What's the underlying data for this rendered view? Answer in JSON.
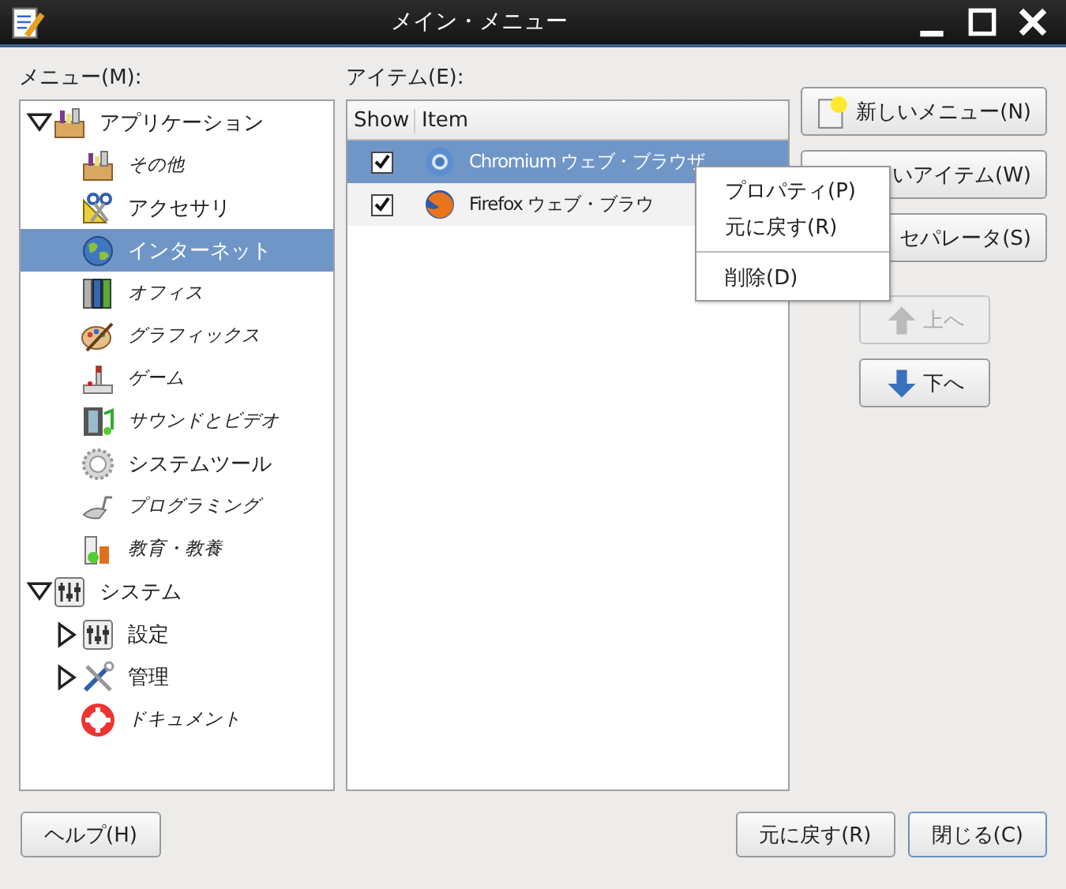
{
  "window": {
    "title": "メイン・メニュー"
  },
  "menu_label": "メニュー(M):",
  "items_label": "アイテム(E):",
  "tree": [
    {
      "label": "アプリケーション",
      "expanded": true,
      "selected": false,
      "italic": false,
      "children": [
        {
          "label": "その他",
          "selected": false,
          "italic": true
        },
        {
          "label": "アクセサリ",
          "selected": false,
          "italic": false
        },
        {
          "label": "インターネット",
          "selected": true,
          "italic": false
        },
        {
          "label": "オフィス",
          "selected": false,
          "italic": true
        },
        {
          "label": "グラフィックス",
          "selected": false,
          "italic": true
        },
        {
          "label": "ゲーム",
          "selected": false,
          "italic": true
        },
        {
          "label": "サウンドとビデオ",
          "selected": false,
          "italic": true
        },
        {
          "label": "システムツール",
          "selected": false,
          "italic": false
        },
        {
          "label": "プログラミング",
          "selected": false,
          "italic": true
        },
        {
          "label": "教育・教養",
          "selected": false,
          "italic": true
        }
      ]
    },
    {
      "label": "システム",
      "expanded": true,
      "selected": false,
      "italic": false,
      "children": [
        {
          "label": "設定",
          "expanded": false,
          "selected": false,
          "italic": false
        },
        {
          "label": "管理",
          "expanded": false,
          "selected": false,
          "italic": false
        },
        {
          "label": "ドキュメント",
          "selected": false,
          "italic": true
        }
      ]
    }
  ],
  "table": {
    "columns": [
      "Show",
      "Item"
    ],
    "rows": [
      {
        "checked": true,
        "item": "Chromium ウェブ・ブラウザ",
        "selected": true
      },
      {
        "checked": true,
        "item": "Firefox ウェブ・ブラウ",
        "selected": false
      }
    ]
  },
  "side_buttons": [
    {
      "label": "新しいメニュー(N)",
      "kind": "new",
      "disabled": false
    },
    {
      "label": "いアイテム(W)",
      "kind": "plain",
      "disabled": false
    },
    {
      "label": "セパレータ(S)",
      "kind": "plain",
      "disabled": false
    }
  ],
  "move_buttons": [
    {
      "label": "上へ",
      "kind": "up",
      "disabled": true
    },
    {
      "label": "下へ",
      "kind": "down",
      "disabled": false
    }
  ],
  "context_menu": [
    {
      "label": "プロパティ(P)",
      "kind": "item"
    },
    {
      "label": "元に戻す(R)",
      "kind": "item"
    },
    {
      "kind": "separator"
    },
    {
      "label": "削除(D)",
      "kind": "item"
    }
  ],
  "footer": {
    "left": [
      "ヘルプ(H)"
    ],
    "right": [
      {
        "label": "元に戻す(R)",
        "default": false
      },
      {
        "label": "閉じる(C)",
        "default": true
      }
    ]
  }
}
